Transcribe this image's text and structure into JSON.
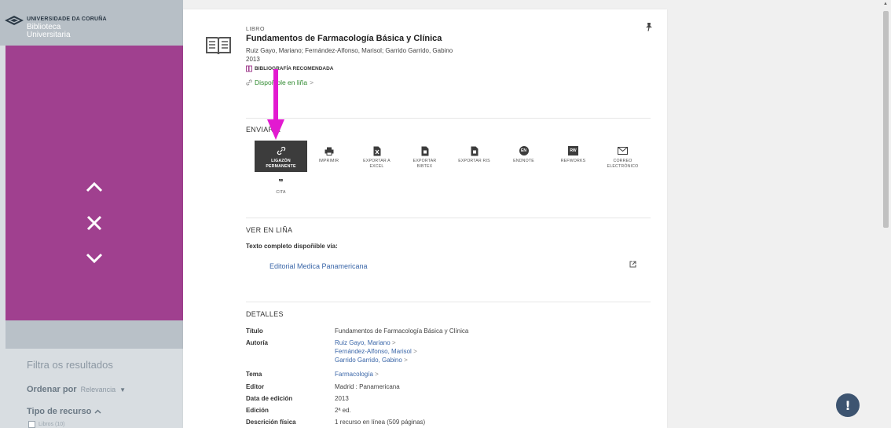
{
  "sidebar": {
    "logo_university": "UNIVERSIDADE DA CORUÑA",
    "logo_library_line1": "Biblioteca",
    "logo_library_line2": "Universitaria",
    "filter_title": "Filtra os resultados",
    "order_label": "Ordenar por",
    "order_value": "Relevancia",
    "resource_type_label": "Tipo de recurso",
    "books_option": "Libros (10)",
    "accent_color": "#a0408f"
  },
  "record": {
    "type": "LIBRO",
    "title": "Fundamentos de Farmacología Básica y Clínica",
    "authors": "Ruiz Gayo, Mariano; Fernández-Alfonso, Marisol; Garrido Garrido, Gabino",
    "year": "2013",
    "badge": "BIBLIOGRAFÍA RECOMENDADA",
    "availability": "Dispoñible en liña",
    "availability_chevron": ">"
  },
  "send": {
    "title": "ENVIAR A",
    "actions": [
      {
        "label_line1": "LIGAZÓN",
        "label_line2": "PERMANENTE",
        "icon": "link-icon"
      },
      {
        "label_line1": "IMPRIMIR",
        "label_line2": "",
        "icon": "printer-icon"
      },
      {
        "label_line1": "EXPORTAR A",
        "label_line2": "EXCEL",
        "icon": "excel-icon"
      },
      {
        "label_line1": "EXPORTAR",
        "label_line2": "BIBTEX",
        "icon": "bibtex-icon"
      },
      {
        "label_line1": "EXPORTAR RIS",
        "label_line2": "",
        "icon": "ris-icon"
      },
      {
        "label_line1": "ENDNOTE",
        "label_line2": "",
        "icon": "endnote-icon",
        "badge": "EN"
      },
      {
        "label_line1": "REFWORKS",
        "label_line2": "",
        "icon": "refworks-icon",
        "badge": "RW"
      },
      {
        "label_line1": "CORREO",
        "label_line2": "ELECTRÓNICO",
        "icon": "mail-icon"
      },
      {
        "label_line1": "CITA",
        "label_line2": "",
        "icon": "quote-icon",
        "glyph": "❞"
      }
    ]
  },
  "online": {
    "title": "VER EN LIÑA",
    "full_text_label": "Texto completo dispoñible vía:",
    "provider": "Editorial Medica Panamericana"
  },
  "details": {
    "title": "DETALLES",
    "rows": [
      {
        "label": "Título",
        "value": "Fundamentos de Farmacología Básica y Clínica"
      },
      {
        "label": "Autoría",
        "values": [
          "Ruiz Gayo, Mariano",
          "Fernández-Alfonso, Marisol",
          "Garrido Garrido, Gabino"
        ]
      },
      {
        "label": "Tema",
        "value": "Farmacología"
      },
      {
        "label": "Editor",
        "value": "Madrid : Panamericana"
      },
      {
        "label": "Data de edición",
        "value": "2013"
      },
      {
        "label": "Edición",
        "value": "2ª ed."
      },
      {
        "label": "Descrición física",
        "value": "1 recurso en línea (509 páginas)"
      }
    ],
    "chevron": ">"
  },
  "overlay": {
    "arrow_color": "#e21ad0"
  }
}
